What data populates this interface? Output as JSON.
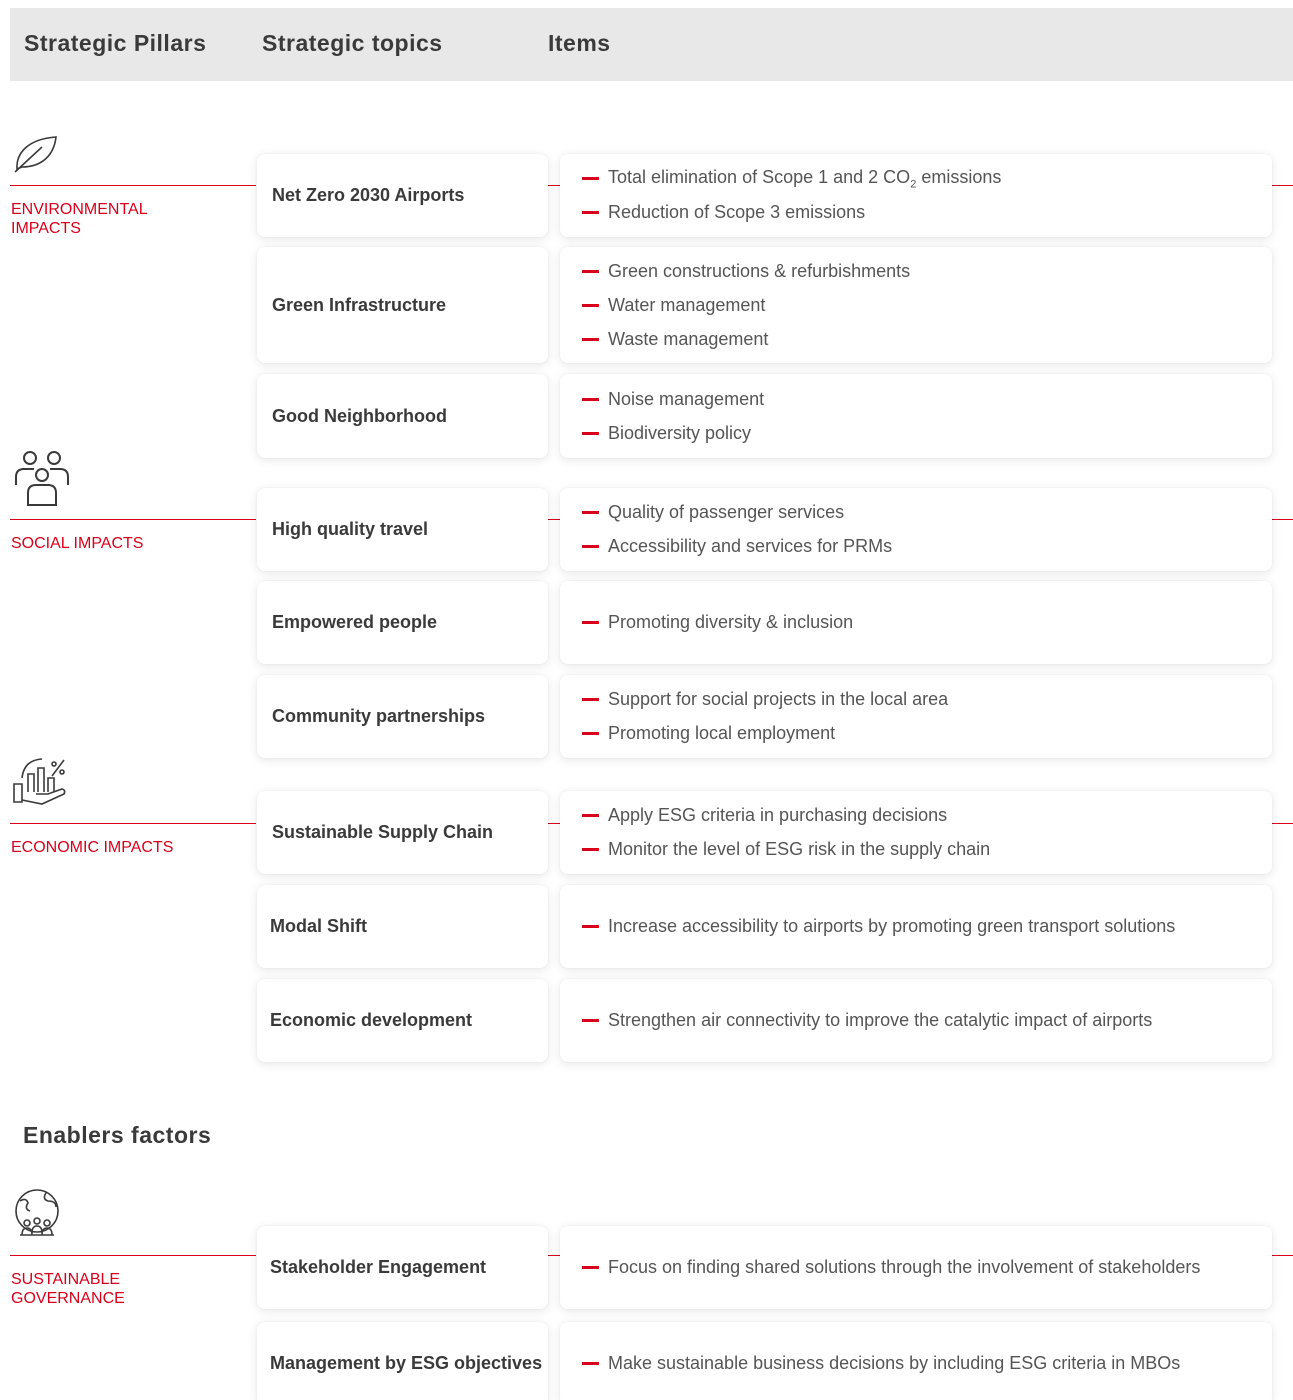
{
  "header": {
    "pillars_label": "Strategic Pillars",
    "topics_label": "Strategic topics",
    "items_label": "Items"
  },
  "pillars": {
    "environmental": {
      "label": "ENVIRONMENTAL IMPACTS",
      "icon": "leaf-icon"
    },
    "social": {
      "label": "SOCIAL IMPACTS",
      "icon": "people-group-icon"
    },
    "economic": {
      "label": "ECONOMIC IMPACTS",
      "icon": "hand-growth-chart-icon"
    },
    "governance": {
      "label": "SUSTAINABLE GOVERNANCE",
      "icon": "globe-people-icon"
    }
  },
  "enablers_title": "Enablers factors",
  "topics": [
    {
      "name": "Net Zero 2030 Airports",
      "items": [
        "Total elimination of Scope 1 and 2 CO",
        "Reduction of Scope 3 emissions"
      ],
      "co2_suffix": "2",
      "co2_tail": " emissions"
    },
    {
      "name": "Green Infrastructure",
      "items": [
        "Green constructions & refurbishments",
        "Water management",
        "Waste management"
      ]
    },
    {
      "name": "Good Neighborhood",
      "items": [
        "Noise management",
        "Biodiversity policy"
      ]
    },
    {
      "name": "High quality travel",
      "items": [
        "Quality of passenger services",
        "Accessibility and services for PRMs"
      ]
    },
    {
      "name": "Empowered people",
      "items": [
        "Promoting diversity & inclusion"
      ]
    },
    {
      "name": "Community partnerships",
      "items": [
        "Support for social projects in the local area",
        "Promoting local employment"
      ]
    },
    {
      "name": "Sustainable Supply Chain",
      "items": [
        "Apply ESG criteria in purchasing decisions",
        "Monitor the level of ESG risk in the supply chain"
      ]
    },
    {
      "name": "Modal Shift",
      "items": [
        "Increase accessibility to airports by promoting green transport solutions"
      ]
    },
    {
      "name": "Economic development",
      "items": [
        "Strengthen air connectivity to improve the catalytic impact of airports"
      ]
    },
    {
      "name": "Stakeholder Engagement",
      "items": [
        "Focus on finding shared solutions through the involvement of stakeholders"
      ]
    },
    {
      "name": "Management by ESG objectives",
      "items": [
        "Make sustainable business decisions by including ESG criteria in MBOs"
      ]
    }
  ],
  "colors": {
    "accent": "#d9001b",
    "header_bg": "#e8e8e9",
    "text": "#3a3a3a"
  }
}
